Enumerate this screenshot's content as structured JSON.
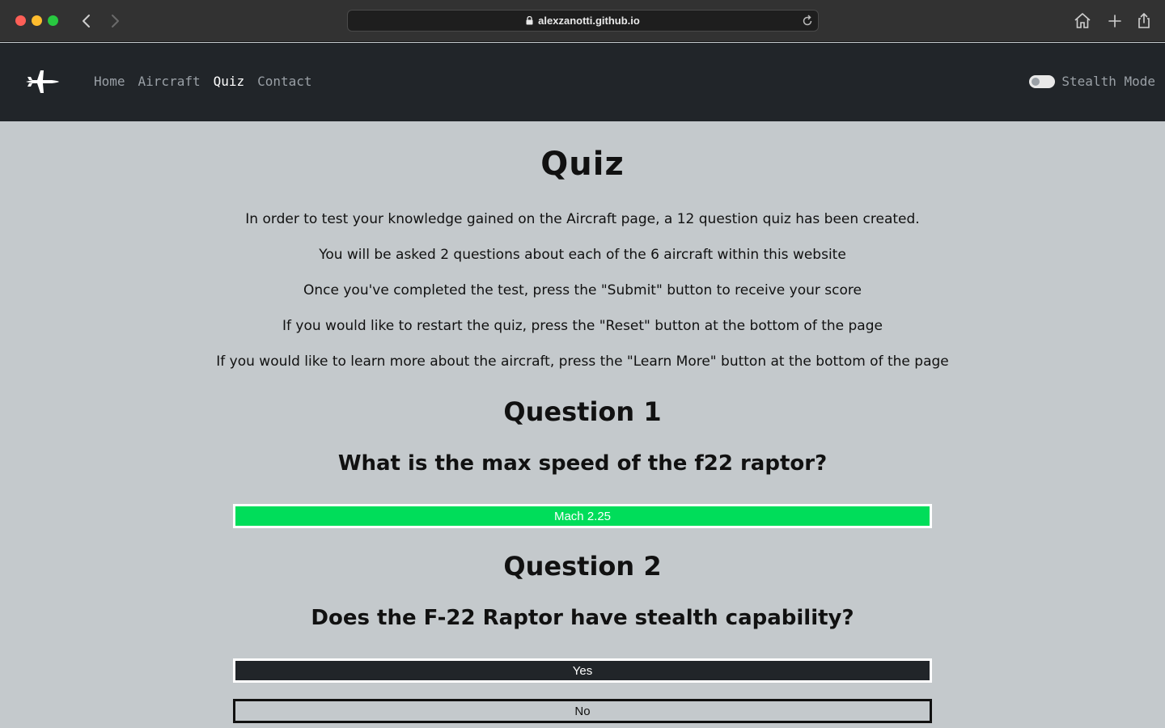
{
  "browser": {
    "url": "alexzanotti.github.io"
  },
  "nav": {
    "links": [
      {
        "label": "Home",
        "active": false
      },
      {
        "label": "Aircraft",
        "active": false
      },
      {
        "label": "Quiz",
        "active": true
      },
      {
        "label": "Contact",
        "active": false
      }
    ],
    "stealth_label": "Stealth Mode",
    "stealth_on": false
  },
  "page": {
    "title": "Quiz",
    "intro": [
      "In order to test your knowledge gained on the Aircraft page, a 12 question quiz has been created.",
      "You will be asked 2 questions about each of the 6 aircraft within this website",
      "Once you've completed the test, press the \"Submit\" button to receive your score",
      "If you would like to restart the quiz, press the \"Reset\" button at the bottom of the page",
      "If you would like to learn more about the aircraft, press the \"Learn More\" button at the bottom of the page"
    ],
    "questions": [
      {
        "heading": "Question 1",
        "text": "What is the max speed of the f22 raptor?",
        "answers": [
          {
            "label": "Mach 2.25",
            "state": "correct"
          }
        ]
      },
      {
        "heading": "Question 2",
        "text": "Does the F-22 Raptor have stealth capability?",
        "answers": [
          {
            "label": "Yes",
            "state": "selected"
          },
          {
            "label": "No",
            "state": "default"
          }
        ]
      }
    ]
  },
  "colors": {
    "page_bg": "#c4c9cc",
    "navbar_bg": "#212529",
    "correct": "#00dd5a",
    "selected": "#212529"
  }
}
